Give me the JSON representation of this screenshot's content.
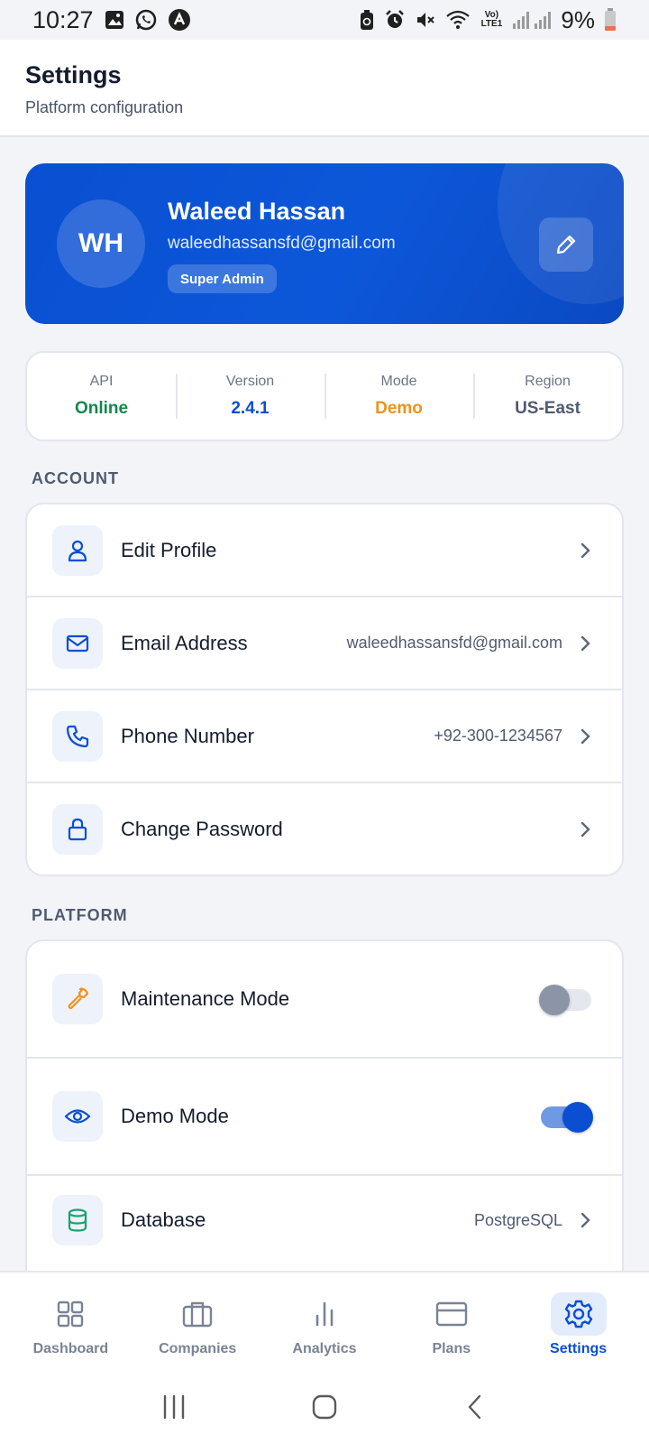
{
  "status_bar": {
    "time": "10:27",
    "battery": "9%",
    "network": "Vo) LTE1",
    "icons": [
      "gallery-icon",
      "whatsapp-icon",
      "app-icon",
      "battery-saver-icon",
      "alarm-icon",
      "mute-icon",
      "wifi-icon",
      "signal-icon"
    ]
  },
  "header": {
    "title": "Settings",
    "subtitle": "Platform configuration"
  },
  "profile": {
    "initials": "WH",
    "name": "Waleed Hassan",
    "email": "waleedhassansfd@gmail.com",
    "role": "Super Admin"
  },
  "stats": [
    {
      "label": "API",
      "value": "Online",
      "color": "#12874a"
    },
    {
      "label": "Version",
      "value": "2.4.1",
      "color": "#0a4fd2"
    },
    {
      "label": "Mode",
      "value": "Demo",
      "color": "#f0921a"
    },
    {
      "label": "Region",
      "value": "US-East",
      "color": "#4f5b70"
    }
  ],
  "account": {
    "title": "ACCOUNT",
    "items": [
      {
        "label": "Edit Profile",
        "value": "",
        "icon": "user-icon"
      },
      {
        "label": "Email Address",
        "value": "waleedhassansfd@gmail.com",
        "icon": "mail-icon"
      },
      {
        "label": "Phone Number",
        "value": "+92-300-1234567",
        "icon": "phone-icon"
      },
      {
        "label": "Change Password",
        "value": "",
        "icon": "lock-icon"
      }
    ]
  },
  "platform": {
    "title": "PLATFORM",
    "items": [
      {
        "label": "Maintenance Mode",
        "icon": "wrench-icon",
        "toggle": false
      },
      {
        "label": "Demo Mode",
        "icon": "eye-icon",
        "toggle": true
      },
      {
        "label": "Database",
        "value": "PostgreSQL",
        "icon": "database-icon"
      }
    ]
  },
  "bottom_nav": {
    "items": [
      {
        "label": "Dashboard",
        "icon": "dashboard-icon",
        "active": false
      },
      {
        "label": "Companies",
        "icon": "briefcase-icon",
        "active": false
      },
      {
        "label": "Analytics",
        "icon": "analytics-icon",
        "active": false
      },
      {
        "label": "Plans",
        "icon": "card-icon",
        "active": false
      },
      {
        "label": "Settings",
        "icon": "gear-icon",
        "active": true
      }
    ]
  },
  "colors": {
    "brand": "#0a4fd2",
    "background": "#f2f4f8",
    "toggle_on": "#0a4fd2",
    "toggle_off": "#8c95a7"
  }
}
